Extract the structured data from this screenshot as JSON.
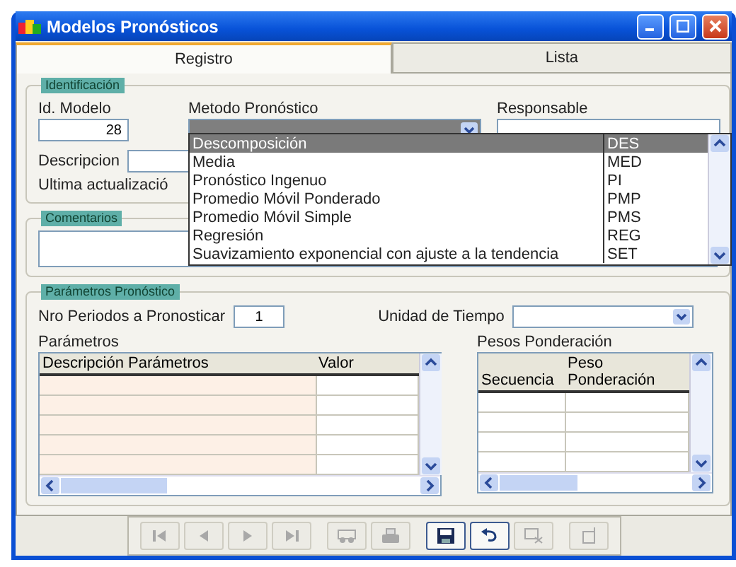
{
  "window": {
    "title": "Modelos Pronósticos"
  },
  "tabs": [
    {
      "label": "Registro",
      "selected": true
    },
    {
      "label": "Lista",
      "selected": false
    }
  ],
  "identificacion": {
    "legend": "Identificación",
    "id_modelo": {
      "label": "Id. Modelo",
      "value": "28"
    },
    "metodo": {
      "label": "Metodo Pronóstico"
    },
    "responsable": {
      "label": "Responsable"
    },
    "descripcion": {
      "label": "Descripcion"
    },
    "ultima_actualizacion": {
      "label": "Ultima actualizació"
    }
  },
  "metodo_dropdown": [
    {
      "name": "Descomposición",
      "code": "DES",
      "selected": true
    },
    {
      "name": "Media",
      "code": "MED",
      "selected": false
    },
    {
      "name": "Pronóstico Ingenuo",
      "code": "PI",
      "selected": false
    },
    {
      "name": "Promedio Móvil Ponderado",
      "code": "PMP",
      "selected": false
    },
    {
      "name": "Promedio Móvil Simple",
      "code": "PMS",
      "selected": false
    },
    {
      "name": "Regresión",
      "code": "REG",
      "selected": false
    },
    {
      "name": "Suavizamiento exponencial con ajuste a la tendencia",
      "code": "SET",
      "selected": false
    }
  ],
  "comentarios": {
    "legend": "Comentarios"
  },
  "parametros_pronostico": {
    "legend": "Parámetros Pronóstico",
    "nro_periodos": {
      "label": "Nro Periodos a Pronosticar",
      "value": "1"
    },
    "unidad_tiempo": {
      "label": "Unidad de Tiempo"
    },
    "parametros_table": {
      "title": "Parámetros",
      "columns": [
        "Descripción Parámetros",
        "Valor"
      ]
    },
    "pesos_table": {
      "title": "Pesos Ponderación",
      "columns": [
        "Secuencia",
        "Peso Ponderación"
      ]
    }
  },
  "toolbar": [
    {
      "kind": "first",
      "disabled": true
    },
    {
      "kind": "prev",
      "disabled": true
    },
    {
      "kind": "next",
      "disabled": true
    },
    {
      "kind": "last",
      "disabled": true
    },
    {
      "kind": "find",
      "disabled": true
    },
    {
      "kind": "print",
      "disabled": true
    },
    {
      "kind": "save",
      "disabled": false
    },
    {
      "kind": "undo",
      "disabled": false
    },
    {
      "kind": "delete",
      "disabled": true
    },
    {
      "kind": "exit",
      "disabled": true
    }
  ]
}
